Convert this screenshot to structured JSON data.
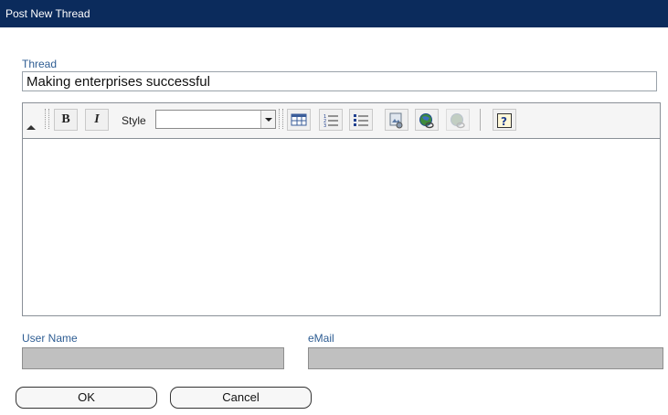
{
  "window": {
    "title": "Post New Thread"
  },
  "thread": {
    "label": "Thread",
    "value": "Making enterprises successful"
  },
  "editor": {
    "toolbar": {
      "bold_label": "B",
      "italic_label": "I",
      "style_label": "Style",
      "style_value": "",
      "icons": [
        "bold-icon",
        "italic-icon",
        "table-icon",
        "numbered-list-icon",
        "bullet-list-icon",
        "insert-image-icon",
        "insert-link-icon",
        "unlink-icon",
        "help-icon"
      ]
    },
    "body_text": ""
  },
  "user": {
    "name_label": "User Name",
    "email_label": "eMail"
  },
  "buttons": {
    "ok": "OK",
    "cancel": "Cancel"
  },
  "colors": {
    "titlebar": "#0b2b5c",
    "label": "#2e5d93",
    "disabled_field": "#c0c0c0"
  }
}
